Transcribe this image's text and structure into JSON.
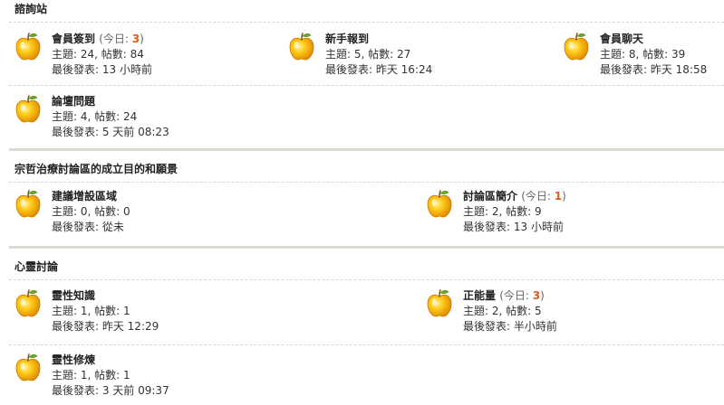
{
  "colors": {
    "today_count": "#e05a1a",
    "separator": "#d9dcd2",
    "apple": "#f5a800"
  },
  "labels": {
    "today_prefix": "(今日: ",
    "today_suffix": ")",
    "topics": "主題: ",
    "posts_sep": ", 帖數: ",
    "last_post": "最後發表: "
  },
  "sections": [
    {
      "title": "諮詢站",
      "forums": [
        {
          "name": "會員簽到",
          "today": "3",
          "topics": "24",
          "posts": "84",
          "last": "13 小時前",
          "icon": "golden-apple-icon"
        },
        {
          "name": "新手報到",
          "today": null,
          "topics": "5",
          "posts": "27",
          "last": "昨天 16:24",
          "icon": "golden-apple-icon"
        },
        {
          "name": "會員聊天",
          "today": null,
          "topics": "8",
          "posts": "39",
          "last": "昨天 18:58",
          "icon": "golden-apple-icon"
        },
        {
          "name": "論壇問題",
          "today": null,
          "topics": "4",
          "posts": "24",
          "last": "5 天前 08:23",
          "icon": "golden-apple-icon"
        }
      ]
    },
    {
      "title": "宗哲治療討論區的成立目的和願景",
      "forums": [
        {
          "name": "建議增設區域",
          "today": null,
          "topics": "0",
          "posts": "0",
          "last": "從未",
          "icon": "golden-apple-icon"
        },
        {
          "name": "討論區簡介",
          "today": "1",
          "topics": "2",
          "posts": "9",
          "last": "13 小時前",
          "icon": "golden-apple-icon"
        }
      ]
    },
    {
      "title": "心靈討論",
      "forums": [
        {
          "name": "靈性知識",
          "today": null,
          "topics": "1",
          "posts": "1",
          "last": "昨天 12:29",
          "icon": "golden-apple-icon"
        },
        {
          "name": "正能量",
          "today": "3",
          "topics": "2",
          "posts": "5",
          "last": "半小時前",
          "icon": "golden-apple-icon"
        },
        {
          "name": "靈性修煉",
          "today": null,
          "topics": "1",
          "posts": "1",
          "last": "3 天前 09:37",
          "icon": "golden-apple-icon"
        }
      ]
    }
  ]
}
